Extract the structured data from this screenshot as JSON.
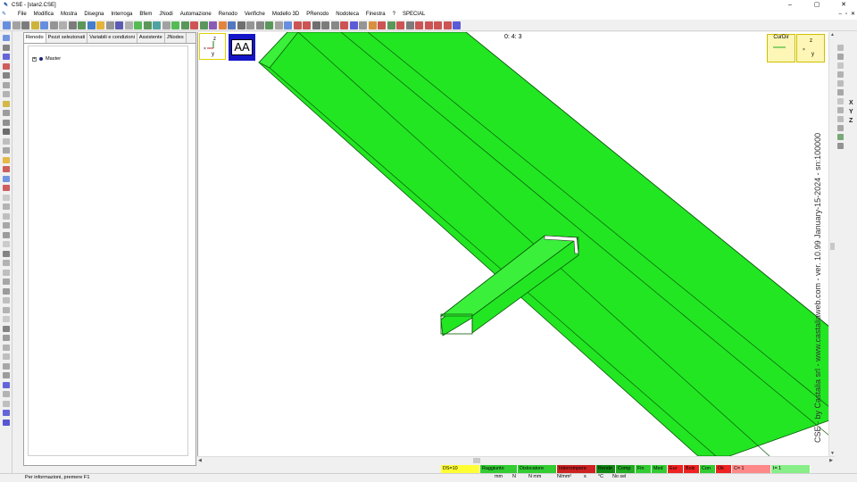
{
  "window": {
    "title": "CSE - [stan2.CSE]",
    "controls": [
      "–",
      "▢",
      "✕"
    ]
  },
  "menu": {
    "items": [
      "File",
      "Modifica",
      "Mostra",
      "Disegna",
      "Interroga",
      "Bfem",
      "JNodi",
      "Automazione",
      "Renodo",
      "Verifiche",
      "Modello 3D",
      "PRenodo",
      "Nodoteca",
      "Finestra",
      "?",
      "SPECIAL"
    ],
    "mdi_controls": [
      "–",
      "▫",
      "✕"
    ]
  },
  "panel": {
    "tabs": [
      "Renodo",
      "Pezzi selezionati",
      "Variabili e condizioni",
      "Assistente",
      "JNodes"
    ],
    "active_tab": 0,
    "tree": {
      "expand": "+",
      "root_label": "Master"
    }
  },
  "viewport": {
    "aa_label": "AA",
    "counter": "0: 4: 3",
    "curdir_label": "CurDir",
    "axis_labels": {
      "z": "z",
      "y": "y"
    },
    "watermark": "CSE - by Castalia srl - www.castaliaweb.com - ver. 10.99 January-15-2024 - sn:100000",
    "model_color": "#22e622",
    "model_edge": "#0a5a0a"
  },
  "right_letters": [
    "X",
    "Y",
    "Z"
  ],
  "status": {
    "info": "Per informazioni, premere F1",
    "cells": [
      {
        "label": "DS=10",
        "color": "#ffff33",
        "w": 44
      },
      {
        "label": "Raggiunto",
        "color": "#33cc33",
        "w": 42
      },
      {
        "label": "Dislocatore",
        "color": "#33cc33",
        "w": 44
      },
      {
        "label": "Interrompere",
        "color": "#cc2222",
        "w": 44
      },
      {
        "label": "Rende",
        "color": "#118811",
        "w": 22
      },
      {
        "label": "Comp",
        "color": "#22aa22",
        "w": 22
      },
      {
        "label": "Fin",
        "color": "#33cc33",
        "w": 18
      },
      {
        "label": "Med",
        "color": "#33cc33",
        "w": 18
      },
      {
        "label": "Eur",
        "color": "#ee2222",
        "w": 18
      },
      {
        "label": "Bolz",
        "color": "#ee2222",
        "w": 18
      },
      {
        "label": "Con",
        "color": "#33cc33",
        "w": 18
      },
      {
        "label": "Ok",
        "color": "#ee2222",
        "w": 18
      },
      {
        "label": "C= 1",
        "color": "#ff8888",
        "w": 44
      },
      {
        "label": "I= 1",
        "color": "#88ee88",
        "w": 44
      }
    ],
    "units": [
      "mm",
      "N",
      "N mm",
      "N/mm²",
      "s",
      "°C",
      "No sel"
    ]
  }
}
